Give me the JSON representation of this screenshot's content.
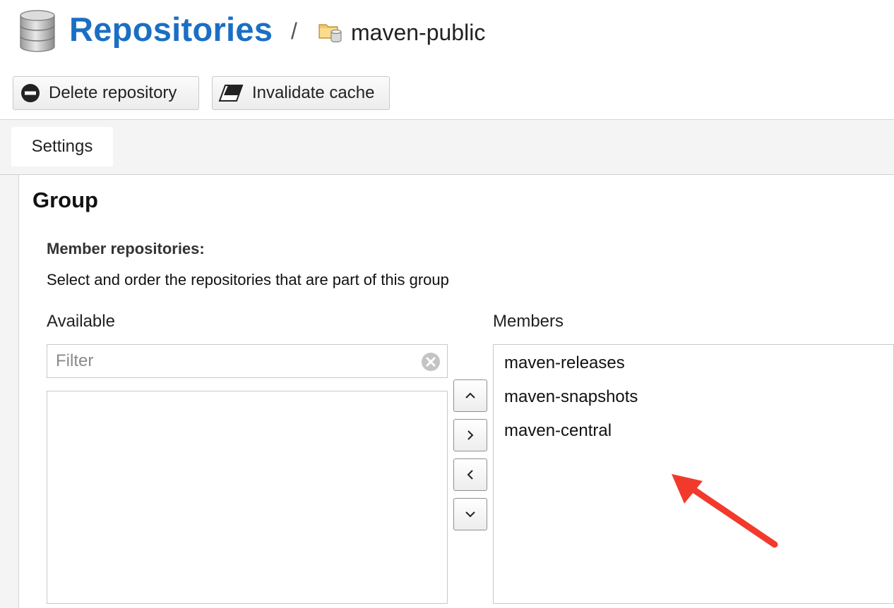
{
  "header": {
    "title": "Repositories",
    "separator": "/",
    "repo_name": "maven-public",
    "title_icon": "database-icon",
    "repo_icon": "folder-database-icon",
    "title_color": "#1a6fc4"
  },
  "toolbar": {
    "delete_label": "Delete repository",
    "delete_icon": "minus-circle-icon",
    "invalidate_label": "Invalidate cache",
    "invalidate_icon": "eraser-icon"
  },
  "tabs": [
    {
      "label": "Settings",
      "active": true
    }
  ],
  "group": {
    "section_title": "Group",
    "field_label": "Member repositories:",
    "field_help": "Select and order the repositories that are part of this group",
    "available_label": "Available",
    "members_label": "Members",
    "filter_placeholder": "Filter",
    "filter_value": "",
    "filter_clear_icon": "clear-circle-icon",
    "available": [],
    "members": [
      "maven-releases",
      "maven-snapshots",
      "maven-central"
    ],
    "move_buttons": [
      {
        "name": "move-up-button",
        "icon": "chevron-up-icon"
      },
      {
        "name": "move-right-button",
        "icon": "chevron-right-icon"
      },
      {
        "name": "move-left-button",
        "icon": "chevron-left-icon"
      },
      {
        "name": "move-down-button",
        "icon": "chevron-down-icon"
      }
    ]
  },
  "annotation": {
    "arrow_color": "#f23a2c",
    "arrow_icon": "annotation-arrow"
  }
}
